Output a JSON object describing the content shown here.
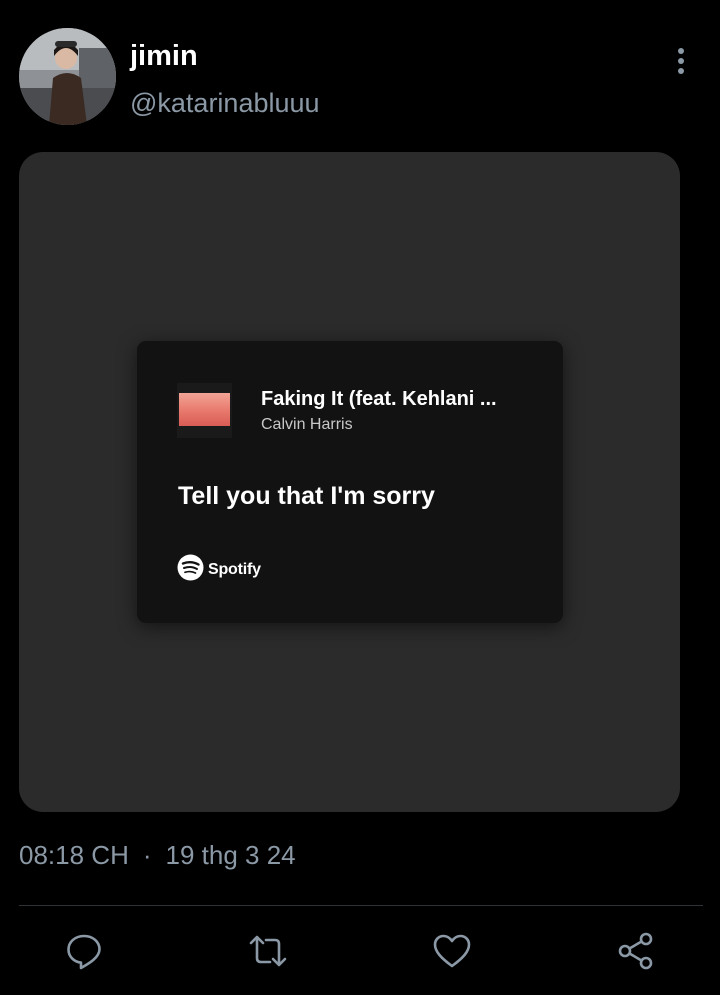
{
  "tweet": {
    "author": {
      "display_name": "jimin",
      "handle": "@katarinabluuu"
    },
    "time": "08:18 CH",
    "separator": "·",
    "date": "19 thg 3 24"
  },
  "lyric_card": {
    "song_title": "Faking It (feat. Kehlani ...",
    "artist": "Calvin Harris",
    "lyric": "Tell you that I'm sorry",
    "brand": "Spotify"
  },
  "actions": [
    "reply-icon",
    "retweet-icon",
    "like-icon",
    "share-icon"
  ],
  "colors": {
    "background": "#000000",
    "media_background": "#2b2b2b",
    "card_background": "#121212",
    "secondary_text": "#8b98a5",
    "icon_color": "#8b98a5"
  }
}
